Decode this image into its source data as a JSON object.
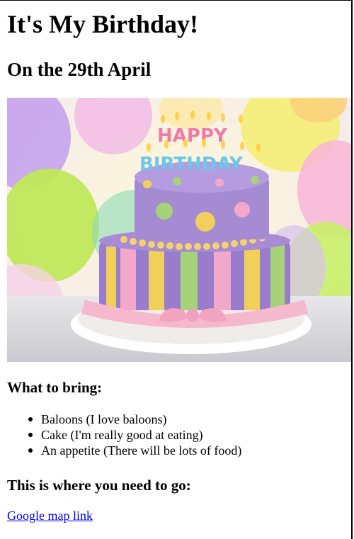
{
  "page": {
    "title": "It's My Birthday!",
    "date_heading": "On the 29th April"
  },
  "image": {
    "alt": "Birthday cake",
    "cake_topper_line1": "HAPPY",
    "cake_topper_line2": "BIRTHDAY",
    "colors": {
      "cake_top": "#a58bd2",
      "cake_bottom": "#9a7ccc",
      "ribbon_pink": "#f5b8cc",
      "stripe_yellow": "#f0cf5a",
      "stripe_green": "#a6d27a",
      "stripe_pink": "#f2a8c8"
    }
  },
  "bring": {
    "heading": "What to bring:",
    "items": [
      "Baloons (I love baloons)",
      "Cake (I'm really good at eating)",
      "An appetite (There will be lots of food)"
    ]
  },
  "location": {
    "heading": "This is where you need to go:",
    "link_text": "Google map link"
  }
}
